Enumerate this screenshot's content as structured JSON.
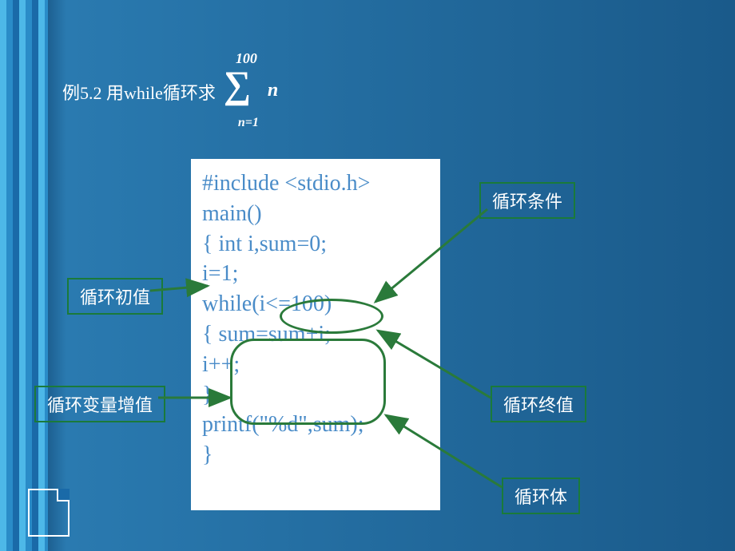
{
  "title": {
    "prefix": "例5.2 用while循环求",
    "sum_upper": "100",
    "sum_lower": "n=1",
    "sum_var": "n"
  },
  "code": {
    "line1": "#include <stdio.h>",
    "line2": "main()",
    "line3": "{   int i,sum=0;",
    "line4": "    i=1;",
    "line5": "    while(i<=100)",
    "line6": "   {  sum=sum+i;",
    "line7": "       i++;",
    "line8": "    }",
    "line9": "    printf(\"%d\",sum);",
    "line10": "}"
  },
  "labels": {
    "condition": "循环条件",
    "initial": "循环初值",
    "increment": "循环变量增值",
    "final": "循环终值",
    "body": "循环体"
  }
}
